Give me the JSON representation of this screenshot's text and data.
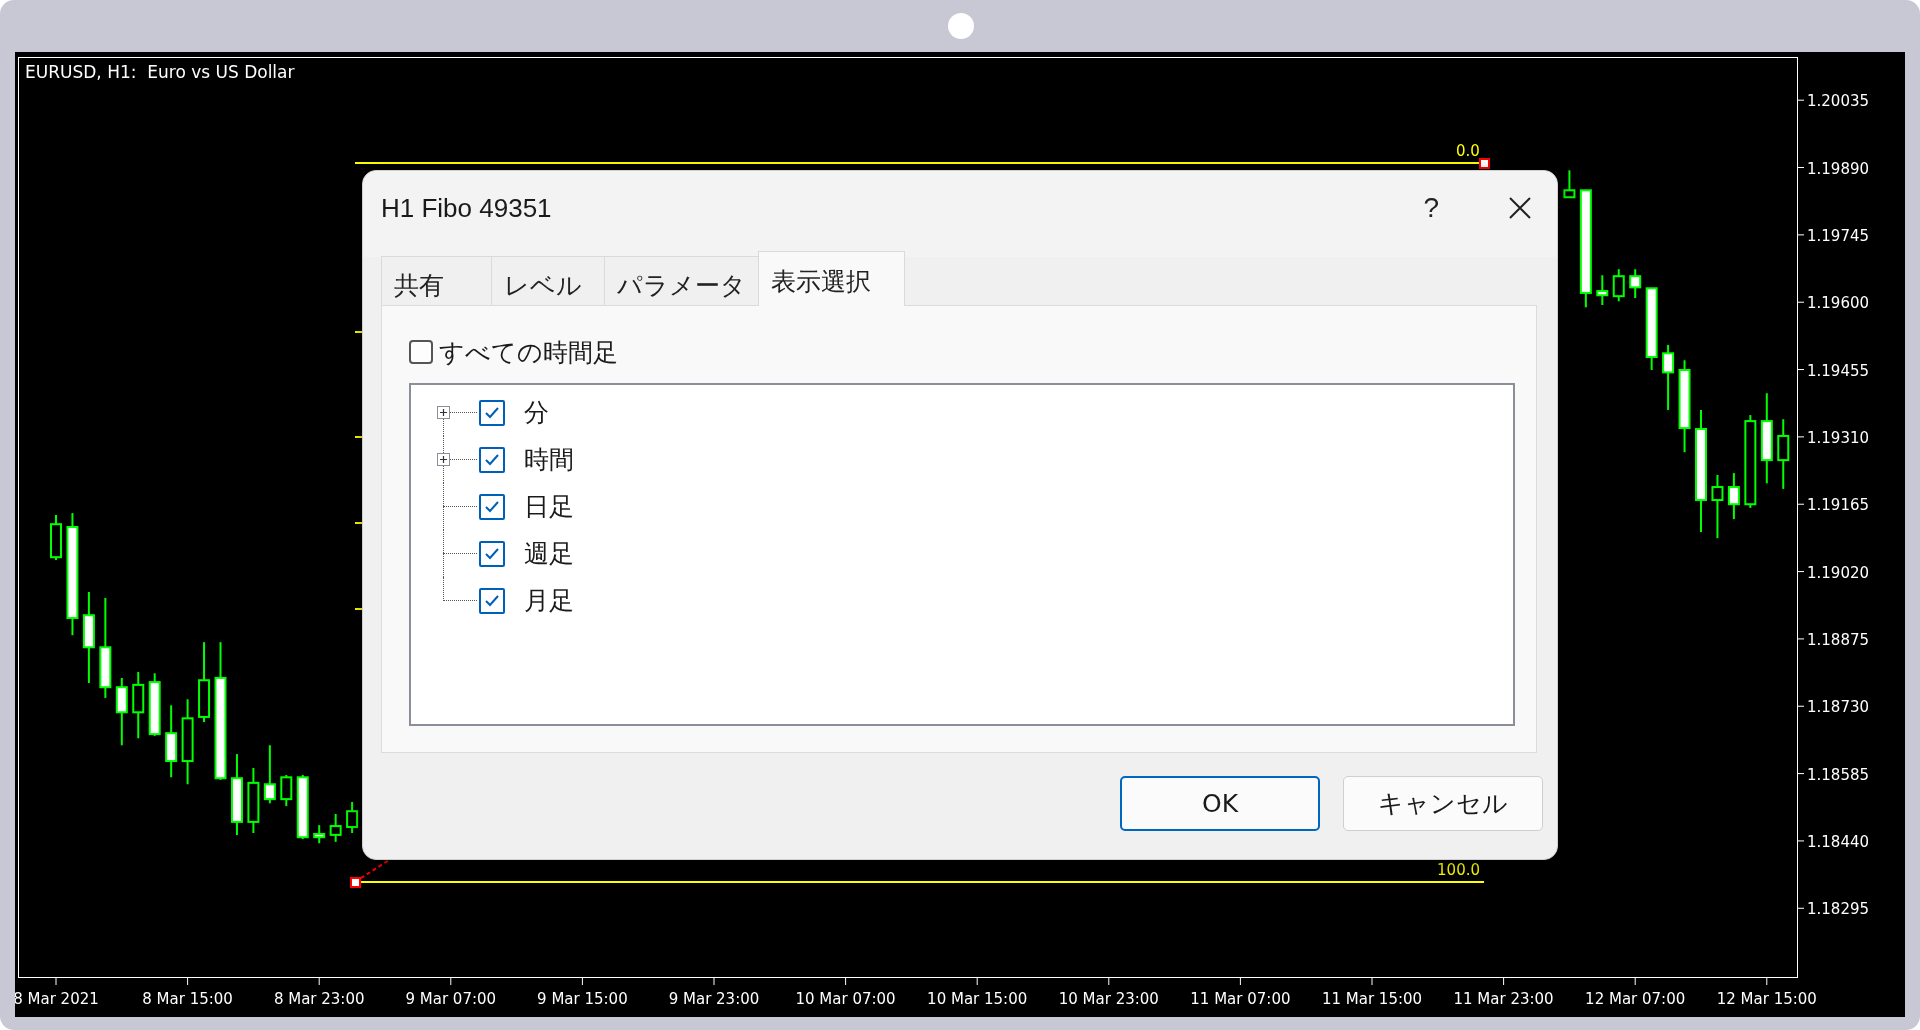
{
  "chart": {
    "title": "EURUSD, H1:  Euro vs US Dollar",
    "fibo_levels": [
      {
        "label": "0.0"
      },
      {
        "label": "100.0"
      }
    ],
    "chart_data": {
      "type": "candlestick",
      "ylim": [
        1.18147,
        1.20128
      ],
      "categories": [
        "8 Mar 2021",
        null,
        null,
        null,
        null,
        null,
        null,
        null,
        "8 Mar 15:00",
        null,
        null,
        null,
        null,
        null,
        null,
        null,
        "8 Mar 23:00",
        null,
        null,
        null,
        null,
        null,
        null,
        null,
        "9 Mar 07:00",
        null,
        null,
        null,
        null,
        null,
        null,
        null,
        "9 Mar 15:00",
        null,
        null,
        null,
        null,
        null,
        null,
        null,
        "9 Mar 23:00",
        null,
        null,
        null,
        null,
        null,
        null,
        null,
        "10 Mar 07:00",
        null,
        null,
        null,
        null,
        null,
        null,
        null,
        "10 Mar 15:00",
        null,
        null,
        null,
        null,
        null,
        null,
        null,
        "10 Mar 23:00",
        null,
        null,
        null,
        null,
        null,
        null,
        null,
        "11 Mar 07:00",
        null,
        null,
        null,
        null,
        null,
        null,
        null,
        "11 Mar 15:00",
        null,
        null,
        null,
        null,
        null,
        null,
        null,
        "11 Mar 23:00",
        null,
        null,
        null,
        null,
        null,
        null,
        null,
        "12 Mar 07:00",
        null,
        null,
        null,
        null,
        null,
        null,
        null,
        "12 Mar 15:00",
        null
      ],
      "ohlc": [
        [
          1.19051,
          1.19142,
          1.19045,
          1.19122
        ],
        [
          1.19116,
          1.19146,
          1.18883,
          1.1892
        ],
        [
          1.18926,
          1.18976,
          1.1878,
          1.18857
        ],
        [
          1.18857,
          1.18963,
          1.18748,
          1.18771
        ],
        [
          1.18771,
          1.18791,
          1.18646,
          1.18717
        ],
        [
          1.18717,
          1.18804,
          1.18661,
          1.18776
        ],
        [
          1.18782,
          1.18801,
          1.18666,
          1.1867
        ],
        [
          1.18672,
          1.18732,
          1.18577,
          1.18612
        ],
        [
          1.18612,
          1.18745,
          1.18562,
          1.18704
        ],
        [
          1.18707,
          1.18868,
          1.18696,
          1.18786
        ],
        [
          1.18791,
          1.18868,
          1.18571,
          1.18575
        ],
        [
          1.18575,
          1.18627,
          1.18453,
          1.18481
        ],
        [
          1.18481,
          1.18597,
          1.18457,
          1.18565
        ],
        [
          1.18562,
          1.18646,
          1.18521,
          1.1853
        ],
        [
          1.1853,
          1.18582,
          1.18515,
          1.18577
        ],
        [
          1.18577,
          1.18582,
          1.18444,
          1.18448
        ],
        [
          1.18455,
          1.18474,
          1.18435,
          1.18448
        ],
        [
          1.18453,
          1.18498,
          1.18438,
          1.18472
        ],
        [
          1.1847,
          1.18524,
          1.18457,
          1.18504
        ],
        null,
        null,
        null,
        null,
        null,
        null,
        null,
        null,
        null,
        null,
        null,
        null,
        null,
        null,
        null,
        null,
        null,
        null,
        null,
        null,
        null,
        null,
        null,
        null,
        null,
        null,
        null,
        null,
        null,
        null,
        null,
        null,
        null,
        null,
        null,
        null,
        null,
        null,
        null,
        null,
        null,
        null,
        null,
        null,
        null,
        null,
        null,
        null,
        null,
        null,
        null,
        null,
        null,
        null,
        null,
        null,
        null,
        null,
        null,
        null,
        null,
        null,
        null,
        null,
        null,
        null,
        null,
        null,
        null,
        null,
        null,
        null,
        null,
        [
          1.19826,
          1.19884,
          1.19826,
          1.19841
        ],
        [
          1.19841,
          1.19841,
          1.19589,
          1.1962
        ],
        [
          1.19624,
          1.19658,
          1.19594,
          1.19615
        ],
        [
          1.19613,
          1.19671,
          1.19602,
          1.19656
        ],
        [
          1.19656,
          1.19671,
          1.19609,
          1.19632
        ],
        [
          1.1963,
          1.1963,
          1.19454,
          1.19482
        ],
        [
          1.1949,
          1.19508,
          1.19368,
          1.19449
        ],
        [
          1.19454,
          1.19475,
          1.19277,
          1.19329
        ],
        [
          1.19327,
          1.19368,
          1.19105,
          1.19174
        ],
        [
          1.19174,
          1.19228,
          1.19092,
          1.19202
        ],
        [
          1.19202,
          1.19232,
          1.19133,
          1.19165
        ],
        [
          1.19165,
          1.19357,
          1.19157,
          1.19344
        ],
        [
          1.19344,
          1.19404,
          1.1921,
          1.1926
        ],
        [
          1.1926,
          1.19348,
          1.19198,
          1.19312
        ]
      ],
      "yticks": [
        {
          "value": 1.20035,
          "label": "1.20035"
        },
        {
          "value": 1.1989,
          "label": "1.19890"
        },
        {
          "value": 1.19745,
          "label": "1.19745"
        },
        {
          "value": 1.196,
          "label": "1.19600"
        },
        {
          "value": 1.19455,
          "label": "1.19455"
        },
        {
          "value": 1.1931,
          "label": "1.19310"
        },
        {
          "value": 1.19165,
          "label": "1.19165"
        },
        {
          "value": 1.1902,
          "label": "1.19020"
        },
        {
          "value": 1.18875,
          "label": "1.18875"
        },
        {
          "value": 1.1873,
          "label": "1.18730"
        },
        {
          "value": 1.18585,
          "label": "1.18585"
        },
        {
          "value": 1.1844,
          "label": "1.18440"
        },
        {
          "value": 1.18295,
          "label": "1.18295"
        }
      ]
    }
  },
  "dialog": {
    "title": "H1 Fibo 49351",
    "help": "?",
    "tabs": [
      {
        "label": "共有",
        "selected": false
      },
      {
        "label": "レベル",
        "selected": false
      },
      {
        "label": "パラメータ",
        "selected": false
      },
      {
        "label": "表示選択",
        "selected": true
      }
    ],
    "all_timeframes": {
      "label": "すべての時間足",
      "checked": false
    },
    "timeframes": [
      {
        "label": "分",
        "checked": true,
        "expanded": false
      },
      {
        "label": "時間",
        "checked": true,
        "expanded": false
      },
      {
        "label": "日足",
        "checked": true
      },
      {
        "label": "週足",
        "checked": true
      },
      {
        "label": "月足",
        "checked": true
      }
    ],
    "buttons": [
      {
        "label": "OK",
        "default": true
      },
      {
        "label": "キャンセル",
        "default": false
      }
    ]
  }
}
